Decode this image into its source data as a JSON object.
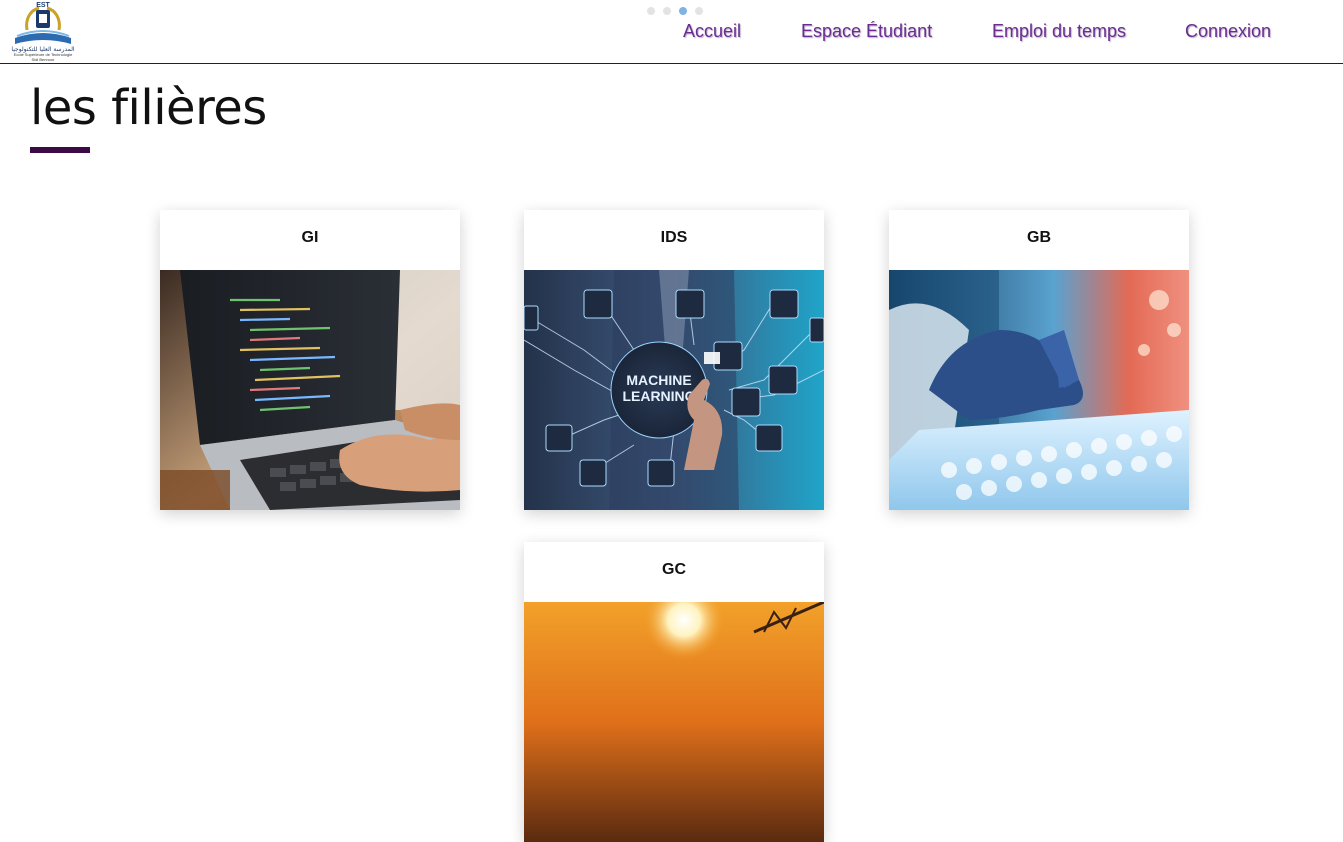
{
  "header": {
    "logo": {
      "icon": "school-emblem-icon",
      "top_text": "EST",
      "arabic_text": "المدرسة العليا للتكنولوجيا",
      "french_text": "Ecole Supérieure de Technologie",
      "sub_text": "Sidi Bennour"
    },
    "carousel_dots": {
      "count": 4,
      "active_index": 2
    },
    "nav": [
      {
        "label": "Accueil"
      },
      {
        "label": "Espace Étudiant"
      },
      {
        "label": "Emploi du temps"
      },
      {
        "label": "Connexion"
      }
    ]
  },
  "main": {
    "title": "les filières",
    "accent_color": "#3d0a47",
    "cards": [
      {
        "label": "GI",
        "image": "laptop-code-photo"
      },
      {
        "label": "IDS",
        "image": "machine-learning-photo",
        "image_text": "MACHINE LEARNING"
      },
      {
        "label": "GB",
        "image": "lab-biology-photo"
      },
      {
        "label": "GC",
        "image": "construction-sunset-photo"
      }
    ]
  },
  "colors": {
    "nav_link": "#6a2c91",
    "dot_active": "#7fb2e6",
    "dot_inactive": "#e3e3e3"
  }
}
